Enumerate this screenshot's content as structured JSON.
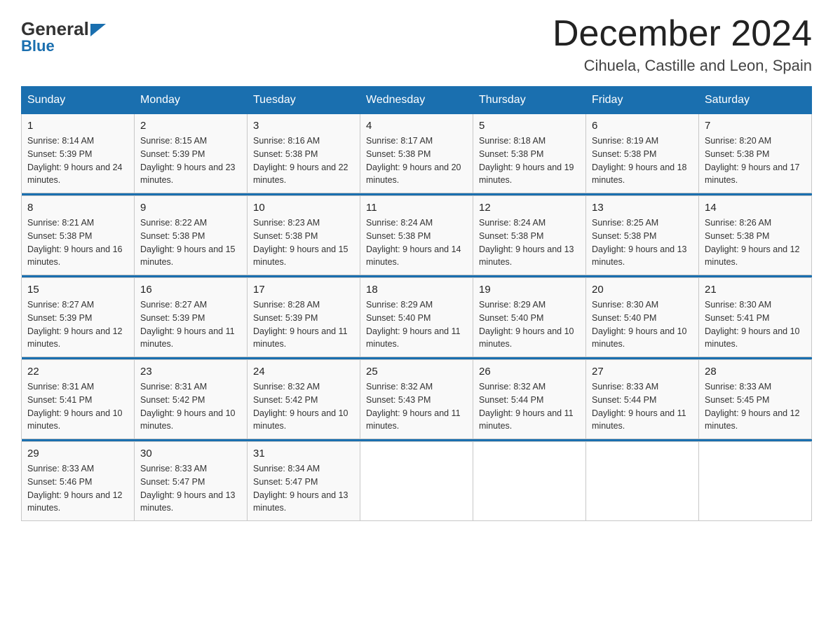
{
  "logo": {
    "general": "General",
    "blue": "Blue"
  },
  "title": "December 2024",
  "subtitle": "Cihuela, Castille and Leon, Spain",
  "days_of_week": [
    "Sunday",
    "Monday",
    "Tuesday",
    "Wednesday",
    "Thursday",
    "Friday",
    "Saturday"
  ],
  "weeks": [
    [
      {
        "day": 1,
        "sunrise": "8:14 AM",
        "sunset": "5:39 PM",
        "daylight": "9 hours and 24 minutes."
      },
      {
        "day": 2,
        "sunrise": "8:15 AM",
        "sunset": "5:39 PM",
        "daylight": "9 hours and 23 minutes."
      },
      {
        "day": 3,
        "sunrise": "8:16 AM",
        "sunset": "5:38 PM",
        "daylight": "9 hours and 22 minutes."
      },
      {
        "day": 4,
        "sunrise": "8:17 AM",
        "sunset": "5:38 PM",
        "daylight": "9 hours and 20 minutes."
      },
      {
        "day": 5,
        "sunrise": "8:18 AM",
        "sunset": "5:38 PM",
        "daylight": "9 hours and 19 minutes."
      },
      {
        "day": 6,
        "sunrise": "8:19 AM",
        "sunset": "5:38 PM",
        "daylight": "9 hours and 18 minutes."
      },
      {
        "day": 7,
        "sunrise": "8:20 AM",
        "sunset": "5:38 PM",
        "daylight": "9 hours and 17 minutes."
      }
    ],
    [
      {
        "day": 8,
        "sunrise": "8:21 AM",
        "sunset": "5:38 PM",
        "daylight": "9 hours and 16 minutes."
      },
      {
        "day": 9,
        "sunrise": "8:22 AM",
        "sunset": "5:38 PM",
        "daylight": "9 hours and 15 minutes."
      },
      {
        "day": 10,
        "sunrise": "8:23 AM",
        "sunset": "5:38 PM",
        "daylight": "9 hours and 15 minutes."
      },
      {
        "day": 11,
        "sunrise": "8:24 AM",
        "sunset": "5:38 PM",
        "daylight": "9 hours and 14 minutes."
      },
      {
        "day": 12,
        "sunrise": "8:24 AM",
        "sunset": "5:38 PM",
        "daylight": "9 hours and 13 minutes."
      },
      {
        "day": 13,
        "sunrise": "8:25 AM",
        "sunset": "5:38 PM",
        "daylight": "9 hours and 13 minutes."
      },
      {
        "day": 14,
        "sunrise": "8:26 AM",
        "sunset": "5:38 PM",
        "daylight": "9 hours and 12 minutes."
      }
    ],
    [
      {
        "day": 15,
        "sunrise": "8:27 AM",
        "sunset": "5:39 PM",
        "daylight": "9 hours and 12 minutes."
      },
      {
        "day": 16,
        "sunrise": "8:27 AM",
        "sunset": "5:39 PM",
        "daylight": "9 hours and 11 minutes."
      },
      {
        "day": 17,
        "sunrise": "8:28 AM",
        "sunset": "5:39 PM",
        "daylight": "9 hours and 11 minutes."
      },
      {
        "day": 18,
        "sunrise": "8:29 AM",
        "sunset": "5:40 PM",
        "daylight": "9 hours and 11 minutes."
      },
      {
        "day": 19,
        "sunrise": "8:29 AM",
        "sunset": "5:40 PM",
        "daylight": "9 hours and 10 minutes."
      },
      {
        "day": 20,
        "sunrise": "8:30 AM",
        "sunset": "5:40 PM",
        "daylight": "9 hours and 10 minutes."
      },
      {
        "day": 21,
        "sunrise": "8:30 AM",
        "sunset": "5:41 PM",
        "daylight": "9 hours and 10 minutes."
      }
    ],
    [
      {
        "day": 22,
        "sunrise": "8:31 AM",
        "sunset": "5:41 PM",
        "daylight": "9 hours and 10 minutes."
      },
      {
        "day": 23,
        "sunrise": "8:31 AM",
        "sunset": "5:42 PM",
        "daylight": "9 hours and 10 minutes."
      },
      {
        "day": 24,
        "sunrise": "8:32 AM",
        "sunset": "5:42 PM",
        "daylight": "9 hours and 10 minutes."
      },
      {
        "day": 25,
        "sunrise": "8:32 AM",
        "sunset": "5:43 PM",
        "daylight": "9 hours and 11 minutes."
      },
      {
        "day": 26,
        "sunrise": "8:32 AM",
        "sunset": "5:44 PM",
        "daylight": "9 hours and 11 minutes."
      },
      {
        "day": 27,
        "sunrise": "8:33 AM",
        "sunset": "5:44 PM",
        "daylight": "9 hours and 11 minutes."
      },
      {
        "day": 28,
        "sunrise": "8:33 AM",
        "sunset": "5:45 PM",
        "daylight": "9 hours and 12 minutes."
      }
    ],
    [
      {
        "day": 29,
        "sunrise": "8:33 AM",
        "sunset": "5:46 PM",
        "daylight": "9 hours and 12 minutes."
      },
      {
        "day": 30,
        "sunrise": "8:33 AM",
        "sunset": "5:47 PM",
        "daylight": "9 hours and 13 minutes."
      },
      {
        "day": 31,
        "sunrise": "8:34 AM",
        "sunset": "5:47 PM",
        "daylight": "9 hours and 13 minutes."
      },
      null,
      null,
      null,
      null
    ]
  ]
}
